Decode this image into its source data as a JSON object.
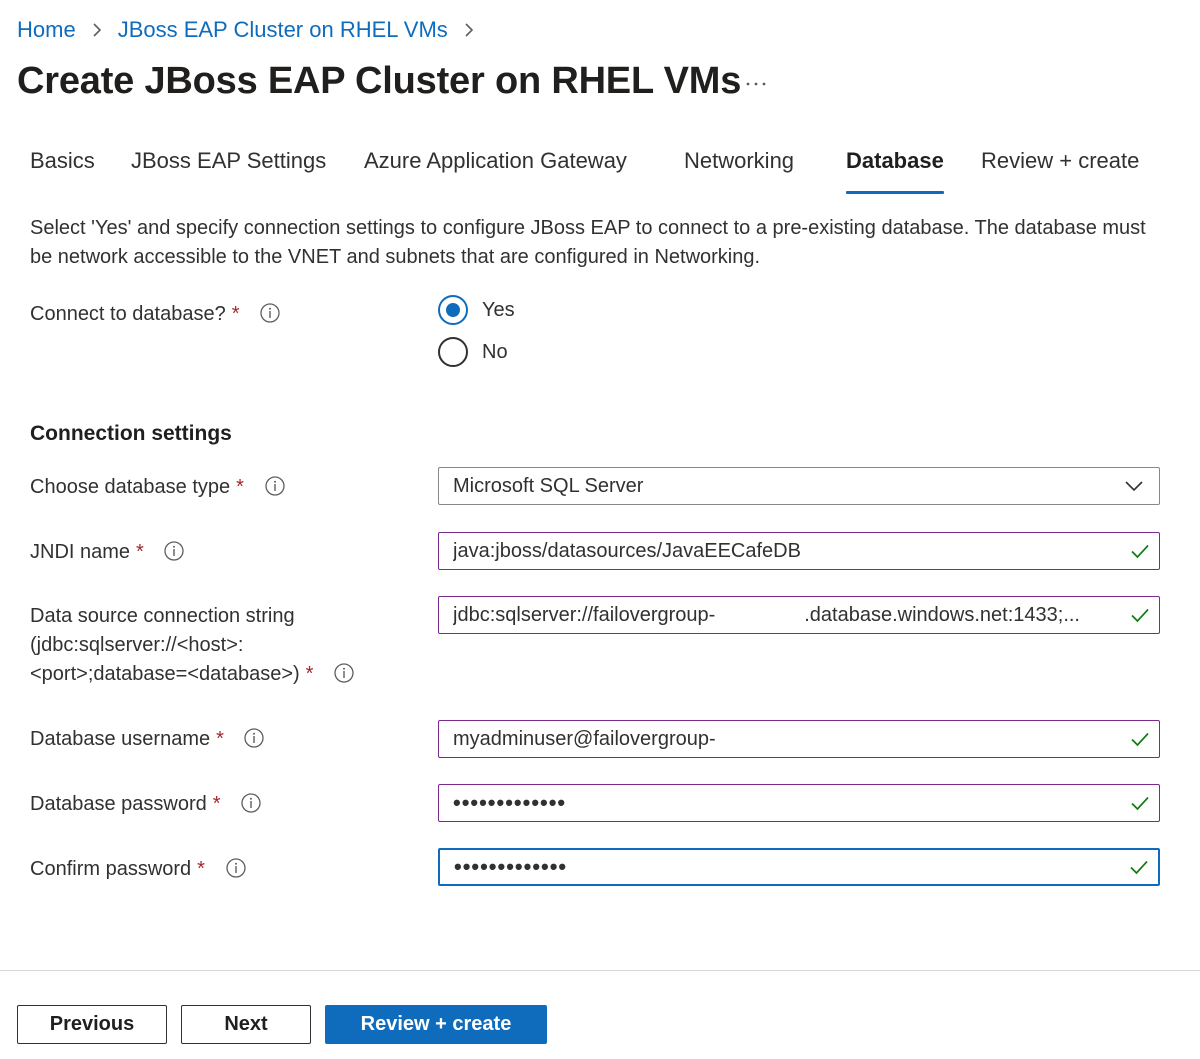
{
  "breadcrumb": {
    "items": [
      {
        "label": "Home"
      },
      {
        "label": "JBoss EAP Cluster on RHEL VMs"
      }
    ]
  },
  "page": {
    "title": "Create JBoss EAP Cluster on RHEL VMs",
    "more_label": "···"
  },
  "tabs": [
    {
      "label": "Basics",
      "active": false
    },
    {
      "label": "JBoss EAP Settings",
      "active": false
    },
    {
      "label": "Azure Application Gateway",
      "active": false
    },
    {
      "label": "Networking",
      "active": false
    },
    {
      "label": "Database",
      "active": true
    },
    {
      "label": "Review + create",
      "active": false
    }
  ],
  "description": "Select 'Yes' and specify connection settings to configure JBoss EAP to connect to a pre-existing database. The database must be network accessible to the VNET and subnets that are configured in Networking.",
  "connect_db": {
    "label": "Connect to database?",
    "required": "*",
    "options": [
      {
        "label": "Yes",
        "checked": true
      },
      {
        "label": "No",
        "checked": false
      }
    ]
  },
  "connection_settings": {
    "heading": "Connection settings",
    "db_type": {
      "label": "Choose database type",
      "required": "*",
      "value": "Microsoft SQL Server"
    },
    "jndi": {
      "label": "JNDI name",
      "required": "*",
      "value": "java:jboss/datasources/JavaEECafeDB"
    },
    "conn_string": {
      "label_line1": "Data source connection string",
      "label_line2": "(jdbc:sqlserver://<host>:",
      "label_line3": "<port>;database=<database>)",
      "required": "*",
      "value": "jdbc:sqlserver://failovergroup-                .database.windows.net:1433;..."
    },
    "username": {
      "label": "Database username",
      "required": "*",
      "value": "myadminuser@failovergroup-"
    },
    "password": {
      "label": "Database password",
      "required": "*",
      "value": "•••••••••••••"
    },
    "confirm_password": {
      "label": "Confirm password",
      "required": "*",
      "value": "•••••••••••••"
    }
  },
  "footer": {
    "previous_label": "Previous",
    "next_label": "Next",
    "review_label": "Review + create"
  },
  "colors": {
    "accent": "#0f6cbd",
    "valid_border": "#7a2a8f",
    "valid_check": "#107c10",
    "required": "#a4262c"
  }
}
